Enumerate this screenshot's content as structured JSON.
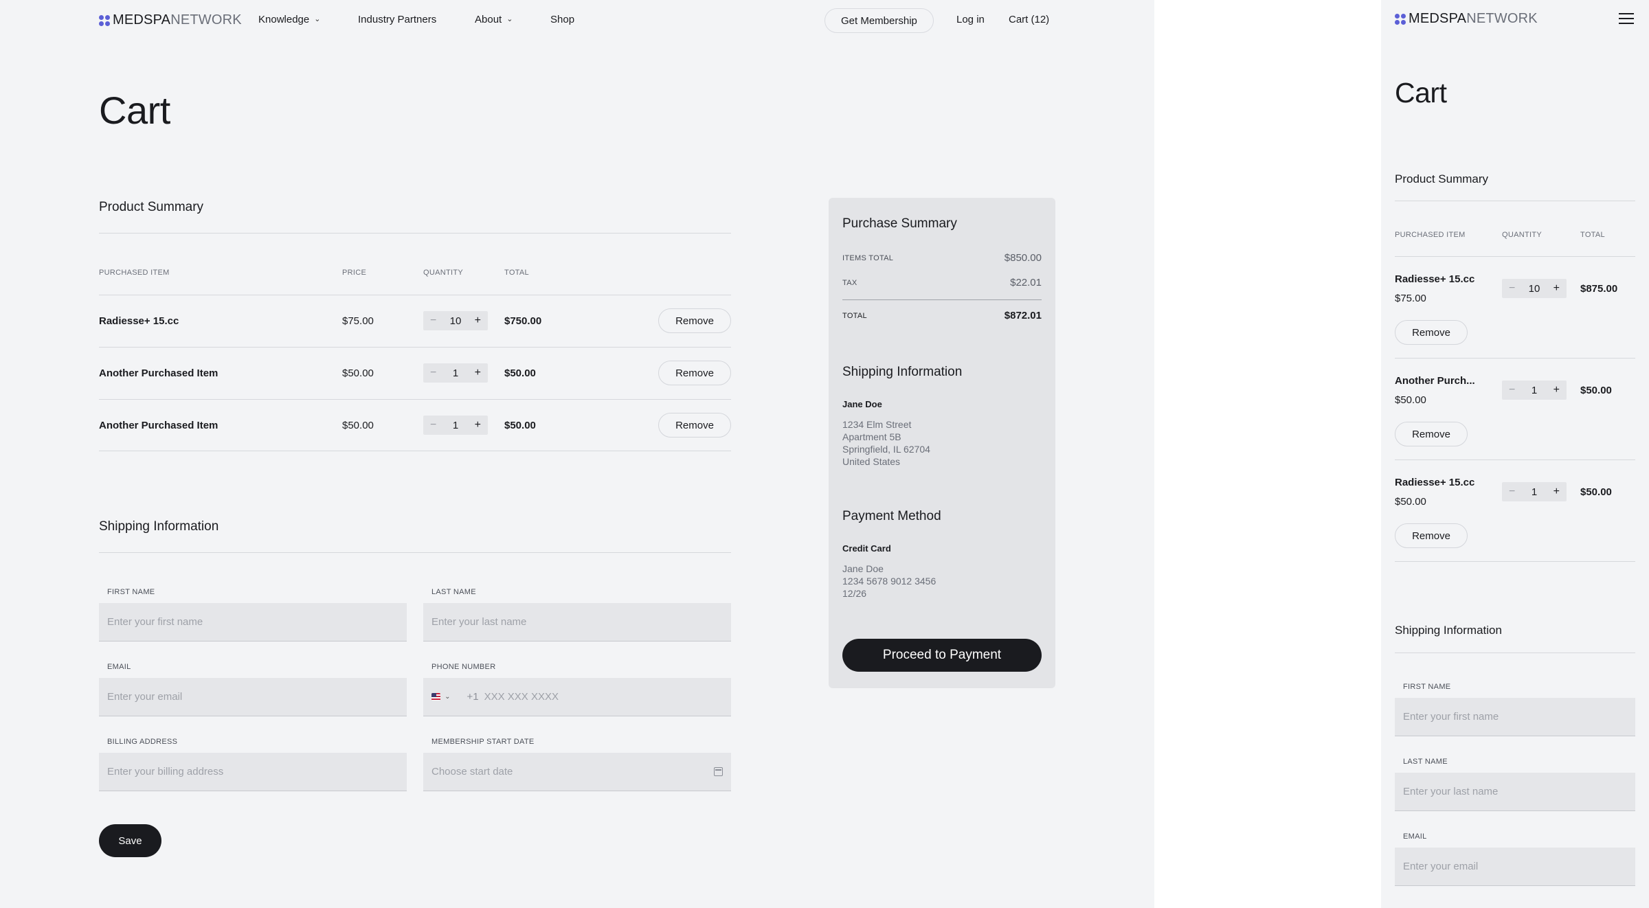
{
  "brand": {
    "part1": "MEDSPA",
    "part2": "NETWORK"
  },
  "nav": {
    "knowledge": "Knowledge",
    "industry_partners": "Industry Partners",
    "about": "About",
    "shop": "Shop",
    "get_membership": "Get Membership",
    "login": "Log in",
    "cart": "Cart (12)"
  },
  "page_title": "Cart",
  "product_summary": {
    "title": "Product Summary",
    "headers": {
      "item": "PURCHASED ITEM",
      "price": "PRICE",
      "quantity": "QUANTITY",
      "total": "TOTAL"
    },
    "rows": [
      {
        "name": "Radiesse+ 15.cc",
        "price": "$75.00",
        "qty": "10",
        "total": "$750.00",
        "remove": "Remove"
      },
      {
        "name": "Another Purchased Item",
        "price": "$50.00",
        "qty": "1",
        "total": "$50.00",
        "remove": "Remove"
      },
      {
        "name": "Another Purchased Item",
        "price": "$50.00",
        "qty": "1",
        "total": "$50.00",
        "remove": "Remove"
      }
    ]
  },
  "shipping_form": {
    "title": "Shipping Information",
    "first_name_label": "FIRST NAME",
    "first_name_placeholder": "Enter your first name",
    "last_name_label": "LAST NAME",
    "last_name_placeholder": "Enter your last name",
    "email_label": "EMAIL",
    "email_placeholder": "Enter your email",
    "phone_label": "PHONE NUMBER",
    "phone_prefix": "+1",
    "phone_placeholder": "XXX XXX XXXX",
    "billing_label": "BILLING ADDRESS",
    "billing_placeholder": "Enter your billing address",
    "start_date_label": "MEMBERSHIP START DATE",
    "start_date_placeholder": "Choose start date",
    "save": "Save"
  },
  "purchase_summary": {
    "title": "Purchase Summary",
    "items_total_label": "ITEMS TOTAL",
    "items_total": "$850.00",
    "tax_label": "TAX",
    "tax": "$22.01",
    "total_label": "TOTAL",
    "total": "$872.01",
    "shipping_title": "Shipping Information",
    "ship_name": "Jane Doe",
    "address_lines": [
      "1234 Elm Street",
      "Apartment 5B",
      "Springfield, IL 62704",
      "United States"
    ],
    "payment_title": "Payment Method",
    "payment_type": "Credit Card",
    "payment_lines": [
      "Jane Doe",
      "1234 5678 9012 3456",
      "12/26"
    ],
    "proceed": "Proceed to Payment"
  },
  "mobile": {
    "rows": [
      {
        "name": "Radiesse+ 15.cc",
        "price": "$75.00",
        "qty": "10",
        "total": "$875.00",
        "remove": "Remove"
      },
      {
        "name": "Another Purch...",
        "price": "$50.00",
        "qty": "1",
        "total": "$50.00",
        "remove": "Remove"
      },
      {
        "name": "Radiesse+ 15.cc",
        "price": "$50.00",
        "qty": "1",
        "total": "$50.00",
        "remove": "Remove"
      }
    ]
  },
  "icons": {
    "menu": "hamburger-menu-icon",
    "calendar": "calendar-icon",
    "flag": "us-flag-icon",
    "chevron": "chevron-down-icon"
  },
  "colors": {
    "background": "#f3f4f6",
    "card": "#e3e4e7",
    "primary_button": "#1a1b1f",
    "logo_mark": "#5b5fd6"
  }
}
